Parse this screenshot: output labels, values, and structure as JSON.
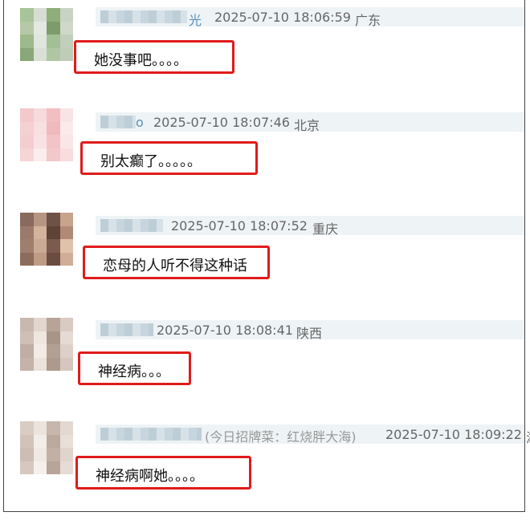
{
  "comments": [
    {
      "name_tail": "光",
      "timestamp": "2025-07-10 18:06:59",
      "location": "广东",
      "content": "她没事吧。。。。",
      "avatar_colors": [
        "#a8c49a",
        "#d7ddd4",
        "#8fae7a",
        "#c9d3c5",
        "#b5c9a6",
        "#e4e7e2",
        "#7d9c6a",
        "#cfd8c9",
        "#9cba8a",
        "#e0e5de",
        "#a3bf95",
        "#c2cfbc",
        "#88a877",
        "#d9dfd5",
        "#b0c6a3",
        "#bfcdb8"
      ]
    },
    {
      "name_tail": "o",
      "timestamp": "2025-07-10 18:07:46",
      "location": "北京",
      "content": "别太癫了。。。。。",
      "avatar_colors": [
        "#f3c9cc",
        "#f7dadb",
        "#f1bfc2",
        "#f9e4e5",
        "#f5d0d2",
        "#f8dfe0",
        "#f0b9bd",
        "#fbeaea",
        "#f4cdd0",
        "#f9e2e3",
        "#f2c4c7",
        "#fae6e7",
        "#f6d5d7",
        "#fbeced",
        "#f3c8cb",
        "#f8dcde"
      ]
    },
    {
      "name_tail": "",
      "timestamp": "2025-07-10 18:07:52",
      "location": "重庆",
      "content": "恋母的人听不得这种话",
      "avatar_colors": [
        "#8a6a5c",
        "#b89583",
        "#6f5246",
        "#c9a48d",
        "#9c7a69",
        "#d4b29c",
        "#5e4338",
        "#b08a74",
        "#a07e6c",
        "#caa995",
        "#7a5b4d",
        "#e0c2ab",
        "#8e6c5b",
        "#bf9b86",
        "#6a4c40",
        "#d0ad97"
      ]
    },
    {
      "name_tail": "",
      "timestamp": "2025-07-10 18:08:41",
      "location": "陕西",
      "content": "神经病。。。",
      "avatar_colors": [
        "#c8b8ae",
        "#e2d6ce",
        "#b7a398",
        "#d9cbc2",
        "#cfbfb5",
        "#efe6e0",
        "#a99488",
        "#e6dbd4",
        "#bfae a3",
        "#f2ebe6",
        "#b3a094",
        "#ddd0c8",
        "#c4b3a8",
        "#ebe2dc",
        "#ad998d",
        "#d5c7be"
      ]
    },
    {
      "name_tail": "",
      "reply_to": "(今日招牌菜：红烧胖大海)",
      "timestamp": "2025-07-10 18:09:22",
      "location": "湖",
      "content": "神经病啊她。。。。",
      "avatar_colors": [
        "#d9ccc3",
        "#ece3dd",
        "#c7b6ab",
        "#e4d9d2",
        "#d2c3b9",
        "#f3ede9",
        "#bca99d",
        "#e8dfd9",
        "#cdbdb2",
        "#efe8e3",
        "#c2b0a5",
        "#e0d4cc",
        "#d6c8bf",
        "#f5f0ec",
        "#b8a498",
        "#e6dcd5"
      ]
    }
  ]
}
